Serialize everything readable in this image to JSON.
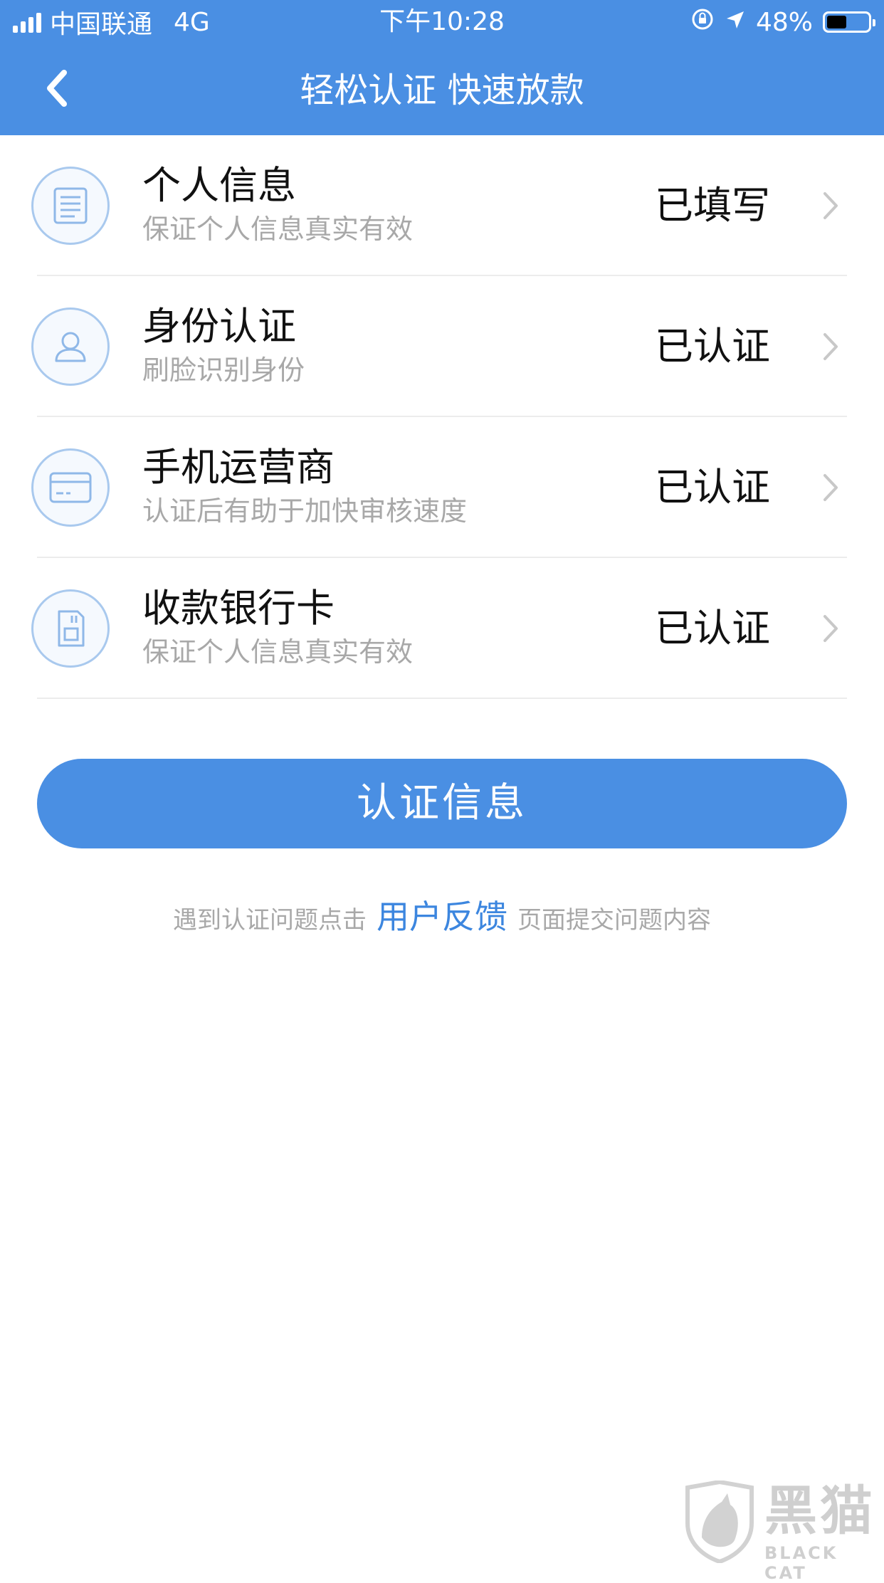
{
  "status_bar": {
    "carrier": "中国联通",
    "network": "4G",
    "time": "下午10:28",
    "battery": "48%",
    "battery_level": 0.48
  },
  "navbar": {
    "title": "轻松认证 快速放款"
  },
  "items": [
    {
      "title": "个人信息",
      "subtitle": "保证个人信息真实有效",
      "status": "已填写",
      "icon": "document-icon"
    },
    {
      "title": "身份认证",
      "subtitle": "刷脸识别身份",
      "status": "已认证",
      "icon": "person-icon"
    },
    {
      "title": "手机运营商",
      "subtitle": "认证后有助于加快审核速度",
      "status": "已认证",
      "icon": "card-icon"
    },
    {
      "title": "收款银行卡",
      "subtitle": "保证个人信息真实有效",
      "status": "已认证",
      "icon": "sim-card-icon"
    }
  ],
  "primary_button": "认证信息",
  "hint": {
    "before": "遇到认证问题点击",
    "link": "用户反馈",
    "after": "页面提交问题内容"
  },
  "watermark": {
    "text": "黑猫",
    "sub": "BLACK CAT"
  },
  "colors": {
    "primary": "#4a8fe3",
    "link": "#3c86df",
    "icon_stroke": "#a9c9ee",
    "muted_text": "#a8a8a8"
  }
}
